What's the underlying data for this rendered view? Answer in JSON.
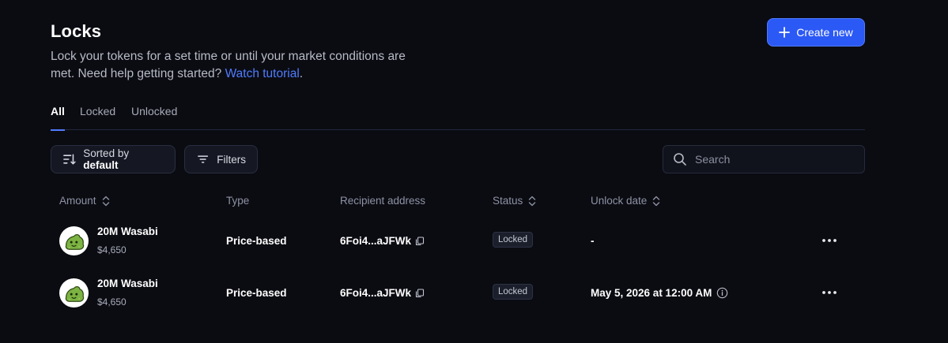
{
  "header": {
    "title": "Locks",
    "subtitle": "Lock your tokens for a set time or until your market conditions are met. Need help getting started?",
    "help_link": "Watch tutorial",
    "subtitle_end": ".",
    "create_button": "Create new"
  },
  "tabs": [
    {
      "label": "All",
      "active": true
    },
    {
      "label": "Locked",
      "active": false
    },
    {
      "label": "Unlocked",
      "active": false
    }
  ],
  "toolbar": {
    "sort_prefix": "Sorted by",
    "sort_value": "default",
    "filters_label": "Filters",
    "search_placeholder": "Search"
  },
  "table": {
    "columns": [
      "Amount",
      "Type",
      "Recipient address",
      "Status",
      "Unlock date"
    ],
    "rows": [
      {
        "token": "20M Wasabi",
        "value": "$4,650",
        "type": "Price-based",
        "address": "6Foi4...aJFWk",
        "status": "Locked",
        "unlock_date": "-"
      },
      {
        "token": "20M Wasabi",
        "value": "$4,650",
        "type": "Price-based",
        "address": "6Foi4...aJFWk",
        "status": "Locked",
        "unlock_date": "May 5, 2026 at 12:00 AM"
      }
    ]
  },
  "colors": {
    "background": "#0b0c12",
    "accent": "#2b59f5",
    "link": "#4f7cff",
    "token_green": "#7cb342"
  }
}
